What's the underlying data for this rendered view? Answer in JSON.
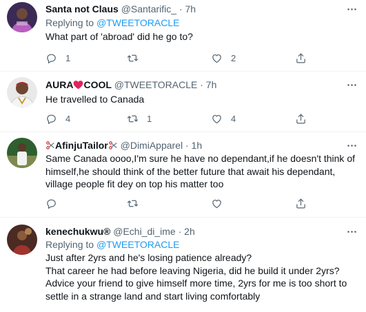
{
  "tweets": [
    {
      "name": "Santa not Claus",
      "handle": "@Santarific_",
      "separator": "·",
      "time": "7h",
      "replying_prefix": "Replying to ",
      "replying_to": "@TWEETORACLE",
      "text": "What part of 'abroad' did he go to?",
      "reply_count": "1",
      "retweet_count": "",
      "like_count": "2"
    },
    {
      "name_part1": "AURA",
      "name_part2": "COOL",
      "handle": "@TWEETORACLE",
      "separator": "·",
      "time": "7h",
      "text": "He travelled to Canada",
      "reply_count": "4",
      "retweet_count": "1",
      "like_count": "4"
    },
    {
      "name": "AfinjuTailor",
      "handle": "@DimiApparel",
      "separator": "·",
      "time": "1h",
      "text": "Same Canada oooo,I'm sure he have no dependant,if he doesn't think of himself,he should think of the better future that await his dependant, village people fit dey on top his matter too",
      "reply_count": "",
      "retweet_count": "",
      "like_count": ""
    },
    {
      "name": "kenechukwu®",
      "handle": "@Echi_di_ime",
      "separator": "·",
      "time": "2h",
      "replying_prefix": "Replying to ",
      "replying_to": "@TWEETORACLE",
      "text_lines": [
        "Just after 2yrs and he's losing patience already?",
        "That career he had before leaving Nigeria, did he build it under 2yrs?",
        "Advice your friend to give himself more time, 2yrs for me is too short to settle in a strange land and start living comfortably"
      ]
    }
  ],
  "colors": {
    "link": "#1d9bf0",
    "secondary": "#536471",
    "text": "#0f1419",
    "divider": "#eff3f4"
  },
  "icons": [
    "more-icon",
    "reply-icon",
    "retweet-icon",
    "like-icon",
    "share-icon",
    "red-heart-emoji",
    "scissors-emoji"
  ]
}
